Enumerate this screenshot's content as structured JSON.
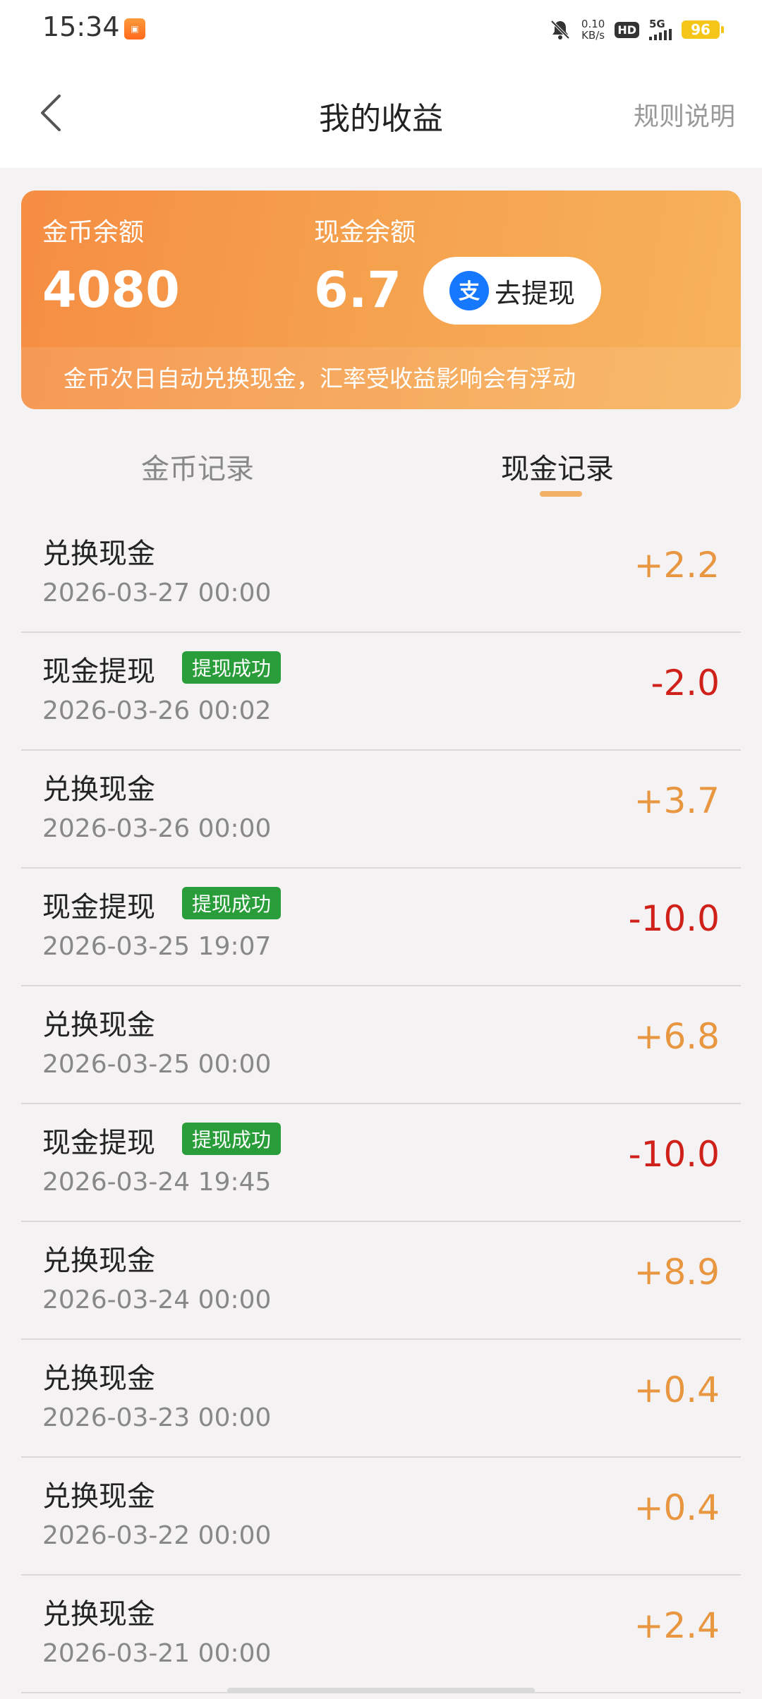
{
  "status_bar": {
    "time": "15:34",
    "net_speed_value": "0.10",
    "net_speed_unit": "KB/s",
    "hd_label": "HD",
    "signal_label": "5G",
    "battery": "96"
  },
  "header": {
    "title": "我的收益",
    "rules_label": "规则说明"
  },
  "balance_card": {
    "coin_label": "金币余额",
    "coin_value": "4080",
    "cash_label": "现金余额",
    "cash_value": "6.7",
    "withdraw_label": "去提现",
    "note": "金币次日自动兑换现金，汇率受收益影响会有浮动"
  },
  "tabs": {
    "coin_records": "金币记录",
    "cash_records": "现金记录",
    "active": "cash_records"
  },
  "records": [
    {
      "title": "兑换现金",
      "time": "2026-03-27 00:00",
      "amount": "+2.2",
      "badge": ""
    },
    {
      "title": "现金提现",
      "time": "2026-03-26 00:02",
      "amount": "-2.0",
      "badge": "提现成功"
    },
    {
      "title": "兑换现金",
      "time": "2026-03-26 00:00",
      "amount": "+3.7",
      "badge": ""
    },
    {
      "title": "现金提现",
      "time": "2026-03-25 19:07",
      "amount": "-10.0",
      "badge": "提现成功"
    },
    {
      "title": "兑换现金",
      "time": "2026-03-25 00:00",
      "amount": "+6.8",
      "badge": ""
    },
    {
      "title": "现金提现",
      "time": "2026-03-24 19:45",
      "amount": "-10.0",
      "badge": "提现成功"
    },
    {
      "title": "兑换现金",
      "time": "2026-03-24 00:00",
      "amount": "+8.9",
      "badge": ""
    },
    {
      "title": "兑换现金",
      "time": "2026-03-23 00:00",
      "amount": "+0.4",
      "badge": ""
    },
    {
      "title": "兑换现金",
      "time": "2026-03-22 00:00",
      "amount": "+0.4",
      "badge": ""
    },
    {
      "title": "兑换现金",
      "time": "2026-03-21 00:00",
      "amount": "+2.4",
      "badge": ""
    }
  ],
  "colors": {
    "positive": "#e8963f",
    "negative": "#d0201a",
    "badge": "#2a9d3b",
    "card_start": "#f58d43",
    "card_end": "#f7b35a",
    "tab_indicator": "#f2b066"
  },
  "icons": {
    "back": "chevron-left-icon",
    "alipay": "alipay-icon",
    "bell_off": "bell-off-icon"
  }
}
